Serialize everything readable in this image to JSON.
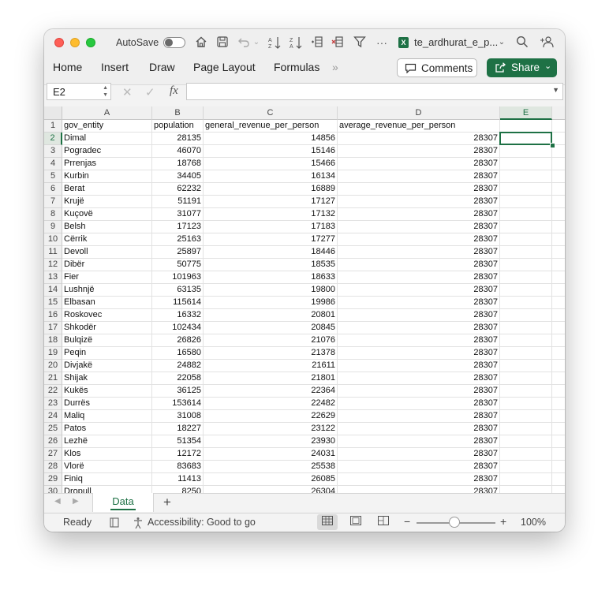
{
  "titlebar": {
    "autosave_label": "AutoSave",
    "autosave_on": false,
    "file_name": "te_ardhurat_e_p...",
    "excel_icon_letter": "X"
  },
  "ribbon": {
    "tabs": [
      "Home",
      "Insert",
      "Draw",
      "Page Layout",
      "Formulas"
    ],
    "more_label": "»",
    "comments_label": "Comments",
    "share_label": "Share"
  },
  "formula_bar": {
    "name_box": "E2",
    "fx_label": "fx",
    "content": ""
  },
  "sheet": {
    "columns": [
      "A",
      "B",
      "C",
      "D",
      "E"
    ],
    "selected_column": "E",
    "selected_row": 2,
    "active_cell": "E2",
    "header_row": [
      "gov_entity",
      "population",
      "general_revenue_per_person",
      "average_revenue_per_person"
    ],
    "rows": [
      [
        "Dimal",
        "28135",
        "14856",
        "28307"
      ],
      [
        "Pogradec",
        "46070",
        "15146",
        "28307"
      ],
      [
        "Prrenjas",
        "18768",
        "15466",
        "28307"
      ],
      [
        "Kurbin",
        "34405",
        "16134",
        "28307"
      ],
      [
        "Berat",
        "62232",
        "16889",
        "28307"
      ],
      [
        "Krujë",
        "51191",
        "17127",
        "28307"
      ],
      [
        "Kuçovë",
        "31077",
        "17132",
        "28307"
      ],
      [
        "Belsh",
        "17123",
        "17183",
        "28307"
      ],
      [
        "Cërrik",
        "25163",
        "17277",
        "28307"
      ],
      [
        "Devoll",
        "25897",
        "18446",
        "28307"
      ],
      [
        "Dibër",
        "50775",
        "18535",
        "28307"
      ],
      [
        "Fier",
        "101963",
        "18633",
        "28307"
      ],
      [
        "Lushnjë",
        "63135",
        "19800",
        "28307"
      ],
      [
        "Elbasan",
        "115614",
        "19986",
        "28307"
      ],
      [
        "Roskovec",
        "16332",
        "20801",
        "28307"
      ],
      [
        "Shkodër",
        "102434",
        "20845",
        "28307"
      ],
      [
        "Bulqizë",
        "26826",
        "21076",
        "28307"
      ],
      [
        "Peqin",
        "16580",
        "21378",
        "28307"
      ],
      [
        "Divjakë",
        "24882",
        "21611",
        "28307"
      ],
      [
        "Shijak",
        "22058",
        "21801",
        "28307"
      ],
      [
        "Kukës",
        "36125",
        "22364",
        "28307"
      ],
      [
        "Durrës",
        "153614",
        "22482",
        "28307"
      ],
      [
        "Maliq",
        "31008",
        "22629",
        "28307"
      ],
      [
        "Patos",
        "18227",
        "23122",
        "28307"
      ],
      [
        "Lezhë",
        "51354",
        "23930",
        "28307"
      ],
      [
        "Klos",
        "12172",
        "24031",
        "28307"
      ],
      [
        "Vlorë",
        "83683",
        "25538",
        "28307"
      ],
      [
        "Finiq",
        "11413",
        "26085",
        "28307"
      ],
      [
        "Dropull",
        "8250",
        "26304",
        "28307"
      ]
    ]
  },
  "sheet_tabs": {
    "active": "Data",
    "add_label": "+"
  },
  "status": {
    "ready": "Ready",
    "accessibility": "Accessibility: Good to go",
    "zoom": "100%",
    "zoom_minus": "−",
    "zoom_plus": "+"
  },
  "colors": {
    "excel_green": "#1e7145",
    "window_bg": "#f3f3f3"
  }
}
